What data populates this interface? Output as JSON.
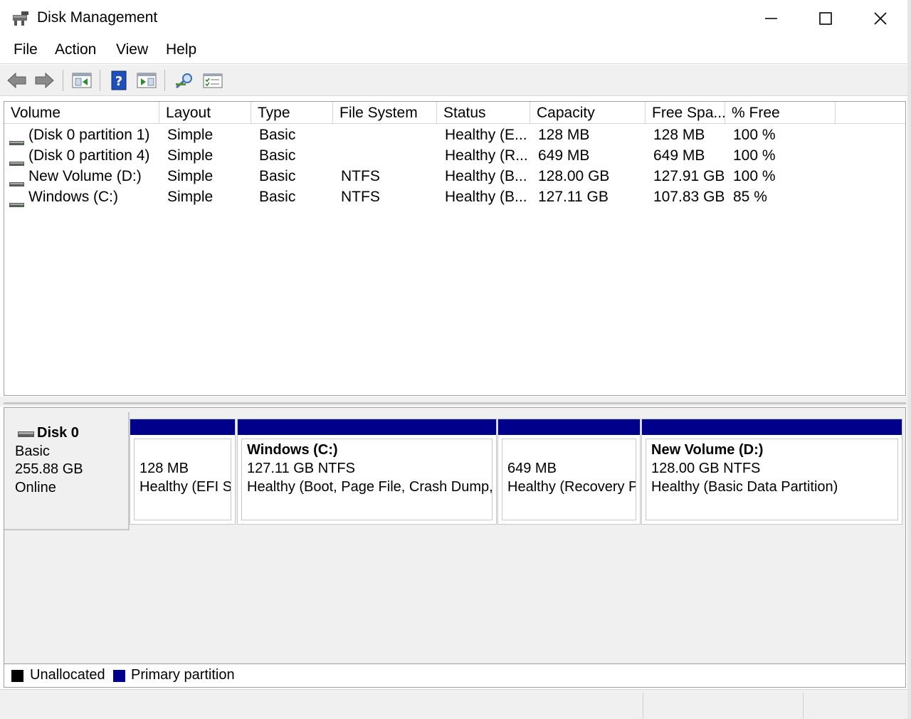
{
  "window": {
    "title": "Disk Management",
    "controls": [
      "minimize-icon",
      "maximize-icon",
      "close-icon"
    ]
  },
  "menu": [
    "File",
    "Action",
    "View",
    "Help"
  ],
  "toolbar": {
    "buttons": [
      "back-icon",
      "forward-icon",
      "show-hide-console-tree-icon",
      "help-icon",
      "properties-icon",
      "connect-icon",
      "details-icon"
    ]
  },
  "volume_list": {
    "columns": [
      "Volume",
      "Layout",
      "Type",
      "File System",
      "Status",
      "Capacity",
      "Free Spa...",
      "% Free"
    ],
    "rows": [
      [
        "(Disk 0 partition 1)",
        "Simple",
        "Basic",
        "",
        "Healthy (E...",
        "128 MB",
        "128 MB",
        "100 %"
      ],
      [
        "(Disk 0 partition 4)",
        "Simple",
        "Basic",
        "",
        "Healthy (R...",
        "649 MB",
        "649 MB",
        "100 %"
      ],
      [
        "New Volume (D:)",
        "Simple",
        "Basic",
        "NTFS",
        "Healthy (B...",
        "128.00 GB",
        "127.91 GB",
        "100 %"
      ],
      [
        "Windows (C:)",
        "Simple",
        "Basic",
        "NTFS",
        "Healthy (B...",
        "127.11 GB",
        "107.83 GB",
        "85 %"
      ]
    ]
  },
  "disk": {
    "name": "Disk 0",
    "type": "Basic",
    "size": "255.88 GB",
    "state": "Online",
    "partitions": [
      {
        "name": "",
        "size": "128 MB",
        "status": "Healthy (EFI System Partition)"
      },
      {
        "name": "Windows  (C:)",
        "size": "127.11 GB NTFS",
        "status": "Healthy (Boot, Page File, Crash Dump, Basic Data Partition)"
      },
      {
        "name": "",
        "size": "649 MB",
        "status": "Healthy (Recovery Partition)"
      },
      {
        "name": "New Volume  (D:)",
        "size": "128.00 GB NTFS",
        "status": "Healthy (Basic Data Partition)"
      }
    ]
  },
  "legend": {
    "unallocated": "Unallocated",
    "primary": "Primary partition",
    "unallocated_color": "#000000",
    "primary_color": "#00008b"
  }
}
